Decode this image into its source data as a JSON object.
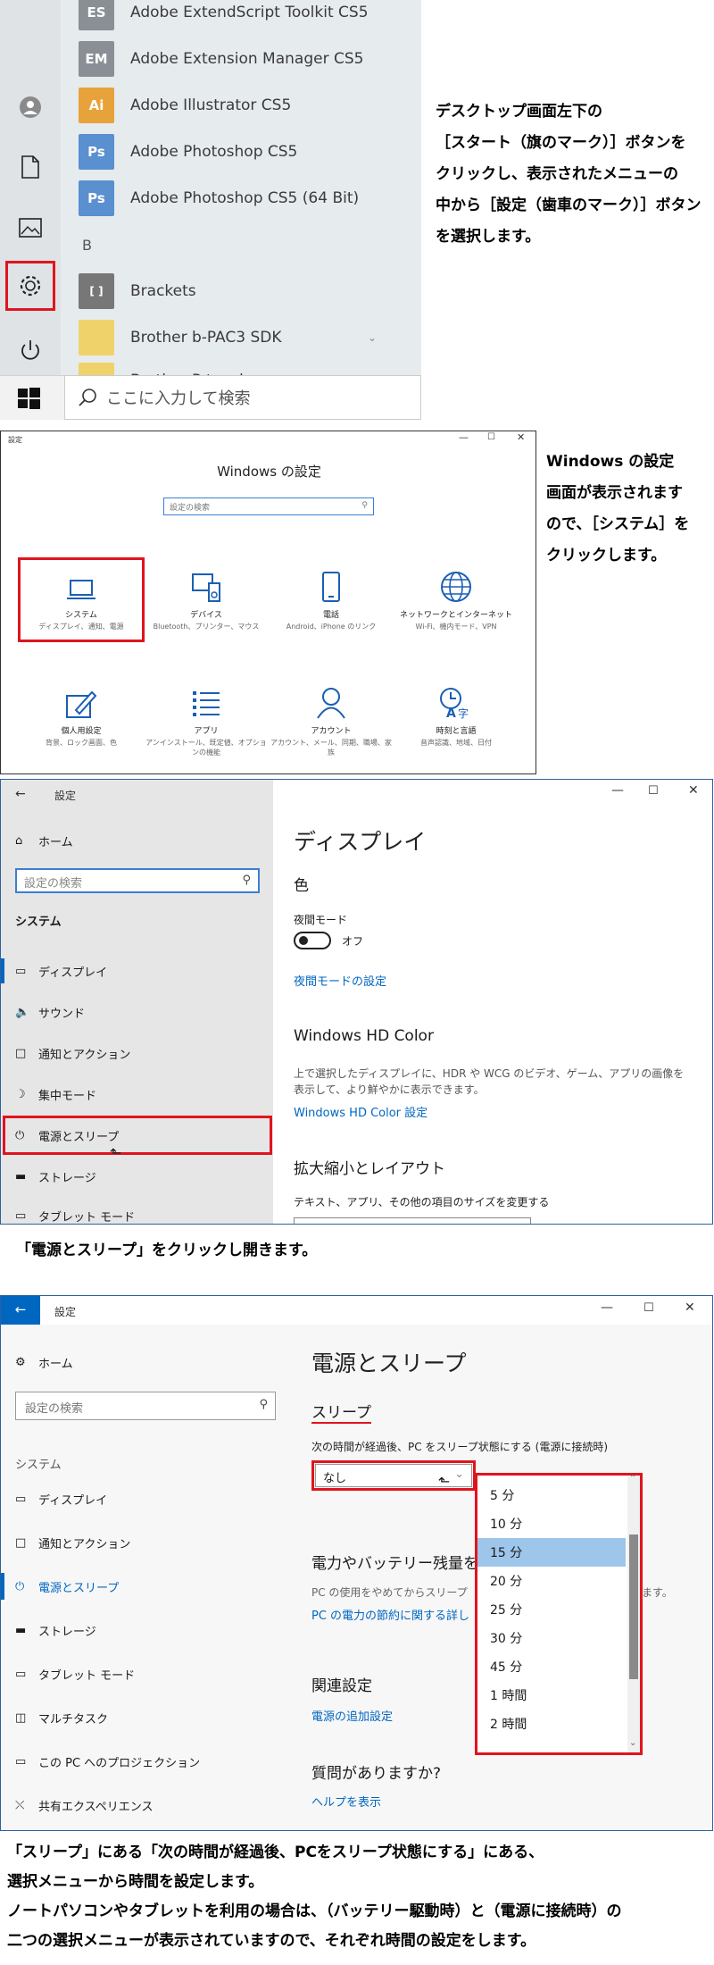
{
  "start_menu": {
    "apps": [
      {
        "label": "Adobe ExtendScript Toolkit CS5",
        "tile": "ES",
        "color": "#8a8f96"
      },
      {
        "label": "Adobe Extension Manager CS5",
        "tile": "EM",
        "color": "#8a8f96"
      },
      {
        "label": "Adobe Illustrator CS5",
        "tile": "Ai",
        "color": "#e8a23a"
      },
      {
        "label": "Adobe Photoshop CS5",
        "tile": "Ps",
        "color": "#5a8fd0"
      },
      {
        "label": "Adobe Photoshop CS5 (64 Bit)",
        "tile": "Ps",
        "color": "#5a8fd0"
      }
    ],
    "section_b": "B",
    "apps_b": [
      {
        "label": "Brackets",
        "tile": "[ ]",
        "color": "#777"
      },
      {
        "label": "Brother b-PAC3 SDK",
        "tile": "",
        "color": "#f0d26a"
      },
      {
        "label": "Brother P-touch",
        "tile": "",
        "color": "#f0d26a"
      }
    ],
    "search_placeholder": "ここに入力して検索"
  },
  "caption1": [
    "デスクトップ画面左下の",
    "［スタート（旗のマーク）］ボタンを",
    "クリックし、表示されたメニューの",
    "中から［設定（歯車のマーク）］ボタン",
    "を選択します。"
  ],
  "settings_home": {
    "window_title": "設定",
    "heading": "Windows の設定",
    "search_placeholder": "設定の検索",
    "categories": [
      {
        "name": "システム",
        "sub": "ディスプレイ、通知、電源",
        "icon": "laptop-icon"
      },
      {
        "name": "デバイス",
        "sub": "Bluetooth、プリンター、マウス",
        "icon": "devices-icon"
      },
      {
        "name": "電話",
        "sub": "Android、iPhone のリンク",
        "icon": "phone-icon"
      },
      {
        "name": "ネットワークとインターネット",
        "sub": "Wi-Fi、機内モード、VPN",
        "icon": "globe-icon"
      },
      {
        "name": "個人用設定",
        "sub": "背景、ロック画面、色",
        "icon": "personalize-icon"
      },
      {
        "name": "アプリ",
        "sub": "アンインストール、既定値、オプションの機能",
        "icon": "apps-icon"
      },
      {
        "name": "アカウント",
        "sub": "アカウント、メール、同期、職場、家族",
        "icon": "account-icon"
      },
      {
        "name": "時刻と言語",
        "sub": "音声認識、地域、日付",
        "icon": "time-language-icon"
      }
    ]
  },
  "caption2": [
    "Windows の設定",
    "画面が表示されます",
    "ので、［システム］を",
    "クリックします。"
  ],
  "display_window": {
    "title": "設定",
    "home": "ホーム",
    "search_placeholder": "設定の検索",
    "section": "システム",
    "nav": [
      {
        "label": "ディスプレイ",
        "icon": "monitor-icon"
      },
      {
        "label": "サウンド",
        "icon": "speaker-icon"
      },
      {
        "label": "通知とアクション",
        "icon": "notification-icon"
      },
      {
        "label": "集中モード",
        "icon": "moon-icon"
      },
      {
        "label": "電源とスリープ",
        "icon": "power-icon"
      },
      {
        "label": "ストレージ",
        "icon": "storage-icon"
      },
      {
        "label": "タブレット モード",
        "icon": "tablet-icon"
      }
    ],
    "page_title": "ディスプレイ",
    "color_heading": "色",
    "night_label": "夜間モード",
    "night_state": "オフ",
    "night_link": "夜間モードの設定",
    "hd_heading": "Windows HD Color",
    "hd_desc1": "上で選択したディスプレイに、HDR や WCG のビデオ、ゲーム、アプリの画像を",
    "hd_desc2": "表示して、より鮮やかに表示できます。",
    "hd_link": "Windows HD Color 設定",
    "scale_heading": "拡大縮小とレイアウト",
    "scale_desc": "テキスト、アプリ、その他の項目のサイズを変更する"
  },
  "caption3": "「電源とスリープ」をクリックし開きます。",
  "power_window": {
    "title": "設定",
    "home": "ホーム",
    "search_placeholder": "設定の検索",
    "section": "システム",
    "nav": [
      {
        "label": "ディスプレイ",
        "icon": "monitor-icon"
      },
      {
        "label": "通知とアクション",
        "icon": "notification-icon"
      },
      {
        "label": "電源とスリープ",
        "icon": "power-icon"
      },
      {
        "label": "ストレージ",
        "icon": "storage-icon"
      },
      {
        "label": "タブレット モード",
        "icon": "tablet-icon"
      },
      {
        "label": "マルチタスク",
        "icon": "multitask-icon"
      },
      {
        "label": "この PC へのプロジェクション",
        "icon": "projection-icon"
      },
      {
        "label": "共有エクスペリエンス",
        "icon": "share-icon"
      }
    ],
    "page_title": "電源とスリープ",
    "sleep_heading": "スリープ",
    "sleep_desc": "次の時間が経過後、PC をスリープ状態にする (電源に接続時)",
    "sleep_value": "なし",
    "options": [
      "5 分",
      "10 分",
      "15 分",
      "20 分",
      "25 分",
      "30 分",
      "45 分",
      "1 時間",
      "2 時間"
    ],
    "selected_option": "15 分",
    "battery_heading": "電力やバッテリー残量を",
    "battery_desc": "PC の使用をやめてからスリープ",
    "battery_desc_tail": "ます。",
    "battery_link": "PC の電力の節約に関する詳し",
    "related_heading": "関連設定",
    "related_link": "電源の追加設定",
    "question_heading": "質問がありますか?",
    "help_link": "ヘルプを表示"
  },
  "caption4": [
    "「スリープ」にある「次の時間が経過後、PCをスリープ状態にする」にある、",
    "選択メニューから時間を設定します。",
    "ノートパソコンやタブレットを利用の場合は、（バッテリー駆動時）と（電源に接続時）の",
    "二つの選択メニューが表示されていますので、それぞれ時間の設定をします。"
  ],
  "colors": {
    "highlight": "#e0141e",
    "accent": "#0067c0",
    "selected": "#9ec5ea"
  }
}
